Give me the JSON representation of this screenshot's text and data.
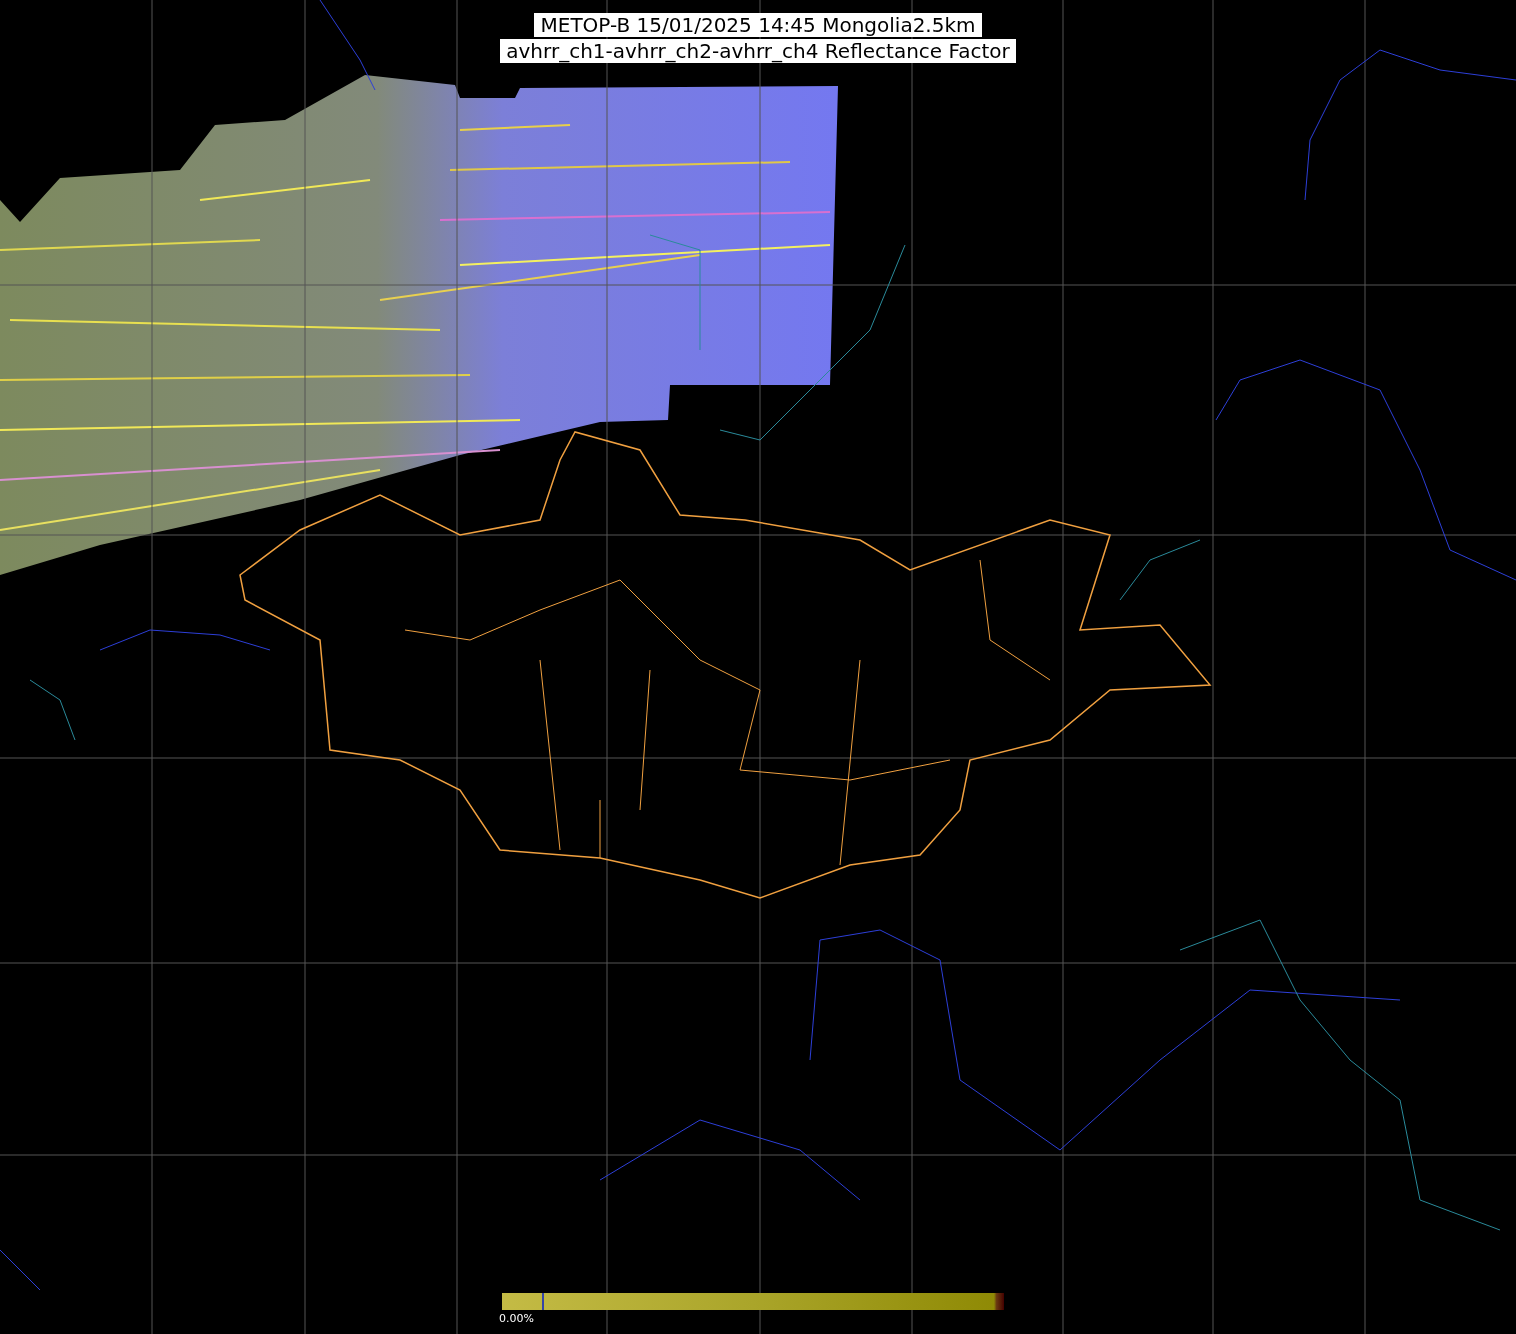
{
  "title": {
    "lines": [
      "METOP-B 15/01/2025 14:45 Mongolia2.5km",
      "avhrr_ch1-avhrr_ch2-avhrr_ch4 Reflectance Factor"
    ]
  },
  "colorbar": {
    "min_label": "0.00%"
  }
}
